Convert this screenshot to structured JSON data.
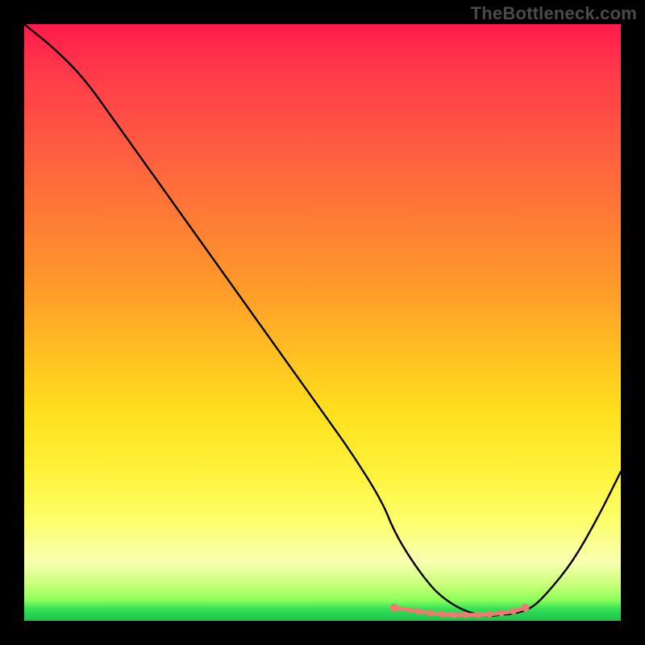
{
  "watermark": {
    "text": "TheBottleneck.com"
  },
  "chart_data": {
    "type": "line",
    "title": "",
    "xlabel": "",
    "ylabel": "",
    "xlim": [
      0,
      100
    ],
    "ylim": [
      0,
      100
    ],
    "grid": false,
    "series": [
      {
        "name": "bottleneck-curve",
        "color": "#000000",
        "x": [
          0,
          5,
          10,
          15,
          20,
          25,
          30,
          35,
          40,
          45,
          50,
          55,
          60,
          62,
          65,
          68,
          70,
          73,
          76,
          78,
          80,
          82,
          85,
          88,
          92,
          96,
          100
        ],
        "y": [
          100,
          96,
          91,
          84,
          77,
          70,
          63,
          56,
          49,
          42,
          35,
          28,
          20,
          15,
          10,
          6,
          4,
          2,
          1,
          0.8,
          1,
          1.2,
          2,
          5,
          10,
          17,
          25
        ]
      }
    ],
    "markers": {
      "name": "optimal-range",
      "color": "#ef7a6f",
      "x": [
        62,
        66,
        68,
        70,
        72,
        74,
        76,
        78,
        80,
        82,
        84
      ],
      "y": [
        2.2,
        1.6,
        1.3,
        1.1,
        1.0,
        1.0,
        1.0,
        1.1,
        1.3,
        1.6,
        2.2
      ]
    }
  }
}
